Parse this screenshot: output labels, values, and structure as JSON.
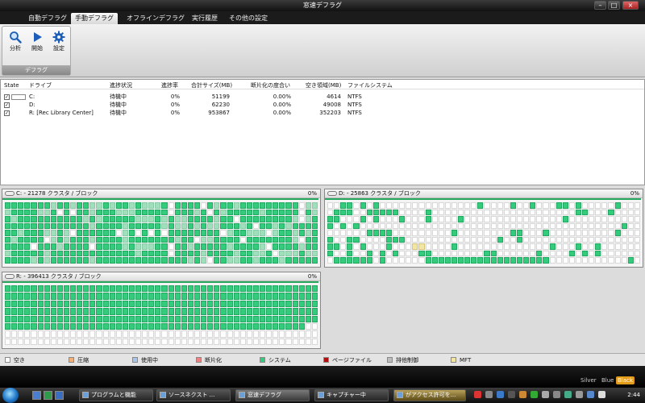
{
  "window": {
    "title": "窓速デフラグ"
  },
  "tabs": [
    "自動デフラグ",
    "手動デフラグ",
    "オフラインデフラグ",
    "実行履歴",
    "その他の設定"
  ],
  "active_tab": "手動デフラグ",
  "ribbon": {
    "group_label": "デフラグ",
    "buttons": [
      {
        "label": "分析",
        "icon": "magnifier-icon"
      },
      {
        "label": "開始",
        "icon": "play-icon"
      },
      {
        "label": "設定",
        "icon": "gear-icon"
      }
    ]
  },
  "drive_list": {
    "columns": [
      "State",
      "ドライブ",
      "進捗状況",
      "進捗率",
      "合計サイズ(MB)",
      "断片化の度合い",
      "空き領域(MB)",
      "ファイルシステム"
    ],
    "rows": [
      {
        "checked": "✓",
        "drive": "C:",
        "status": "待機中",
        "progress": "0%",
        "total": "51199",
        "frag": "0.00%",
        "free": "4614",
        "fs": "NTFS"
      },
      {
        "checked": "✓",
        "drive": "D:",
        "status": "待機中",
        "progress": "0%",
        "total": "62230",
        "frag": "0.00%",
        "free": "49008",
        "fs": "NTFS"
      },
      {
        "checked": "✓",
        "drive": "R: [Rec Library Center]",
        "status": "待機中",
        "progress": "0%",
        "total": "953867",
        "frag": "0.00%",
        "free": "352203",
        "fs": "NTFS"
      }
    ]
  },
  "panels": {
    "c": {
      "title": "C: - 21278 クラスタ / ブロック",
      "percent": "0%"
    },
    "d": {
      "title": "D: - 25863 クラスタ / ブロック",
      "percent": "0%"
    },
    "r": {
      "title": "R: - 396413 クラスタ / ブロック",
      "percent": "0%"
    }
  },
  "legend": [
    {
      "label": "空き",
      "color": "#ffffff"
    },
    {
      "label": "圧縮",
      "color": "#f0b07c"
    },
    {
      "label": "使用中",
      "color": "#a8c4f0"
    },
    {
      "label": "断片化",
      "color": "#f08080"
    },
    {
      "label": "システム",
      "color": "#32cc7c"
    },
    {
      "label": "ページファイル",
      "color": "#b01010"
    },
    {
      "label": "排他制御",
      "color": "#bdbdbd"
    },
    {
      "label": "MFT",
      "color": "#f3e6a3"
    }
  ],
  "themes": [
    "Silver",
    "Blue",
    "Black"
  ],
  "active_theme": "Black",
  "taskbar": {
    "tasks": [
      "プログラムと機能",
      "ソースネクスト ...",
      "窓速デフラグ",
      "キャプチャー中",
      "がアクセス許可を..."
    ],
    "clock": "2:44"
  }
}
